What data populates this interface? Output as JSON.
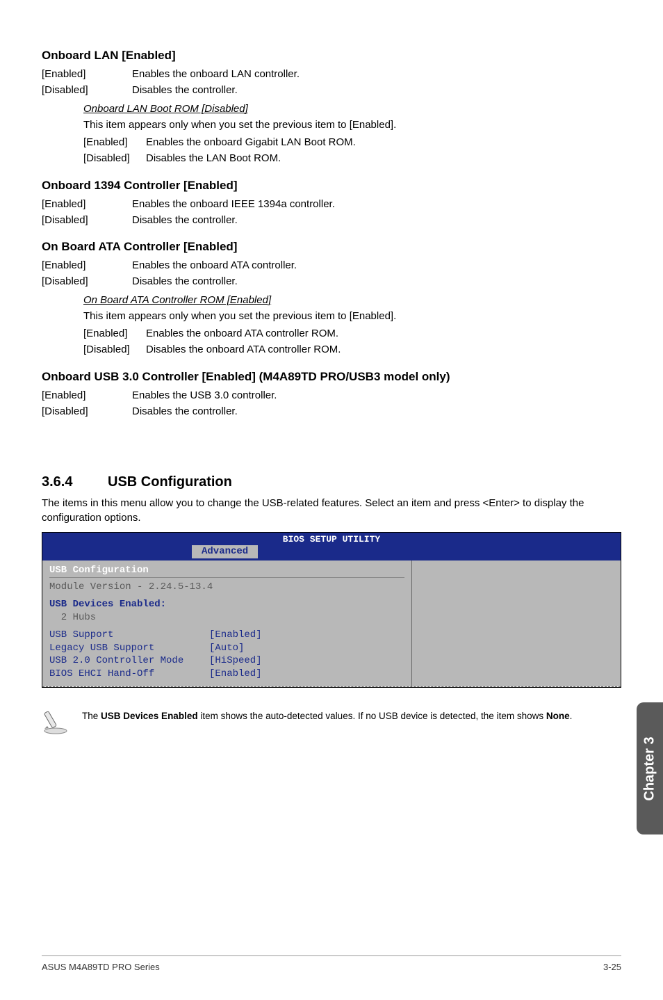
{
  "sections": {
    "onboard_lan": {
      "heading": "Onboard LAN [Enabled]",
      "rows": [
        {
          "key": "[Enabled]",
          "val": "Enables the onboard LAN controller."
        },
        {
          "key": "[Disabled]",
          "val": "Disables the controller."
        }
      ],
      "sub": {
        "heading": "Onboard LAN Boot ROM [Disabled]",
        "text": "This item appears only when you set the previous item to [Enabled].",
        "rows": [
          {
            "key": "[Enabled]",
            "val": "Enables the onboard Gigabit LAN Boot ROM."
          },
          {
            "key": "[Disabled]",
            "val": "Disables the LAN Boot ROM."
          }
        ]
      }
    },
    "onboard_1394": {
      "heading": "Onboard 1394 Controller [Enabled]",
      "rows": [
        {
          "key": "[Enabled]",
          "val": "Enables the onboard IEEE 1394a controller."
        },
        {
          "key": "[Disabled]",
          "val": "Disables the controller."
        }
      ]
    },
    "onboard_ata": {
      "heading": "On Board ATA Controller [Enabled]",
      "rows": [
        {
          "key": "[Enabled]",
          "val": "Enables the onboard ATA controller."
        },
        {
          "key": "[Disabled]",
          "val": "Disables the controller."
        }
      ],
      "sub": {
        "heading": "On Board ATA Controller ROM [Enabled]",
        "text": "This item appears only when you set the previous item to [Enabled].",
        "rows": [
          {
            "key": "[Enabled]",
            "val": "Enables the onboard ATA controller ROM."
          },
          {
            "key": "[Disabled]",
            "val": "Disables the onboard ATA controller ROM."
          }
        ]
      }
    },
    "onboard_usb3": {
      "heading": "Onboard USB 3.0 Controller [Enabled]  (M4A89TD PRO/USB3 model only)",
      "rows": [
        {
          "key": "[Enabled]",
          "val": "Enables the USB 3.0 controller."
        },
        {
          "key": "[Disabled]",
          "val": "Disables the controller."
        }
      ]
    }
  },
  "usb_config": {
    "heading_num": "3.6.4",
    "heading_title": "USB Configuration",
    "intro": "The items in this menu allow you to change the USB-related features. Select an item and press <Enter> to display the configuration options."
  },
  "bios": {
    "title": "BIOS SETUP UTILITY",
    "tab": "Advanced",
    "cfg_title": "USB Configuration",
    "module_version": "Module Version - 2.24.5-13.4",
    "devices_heading": "USB Devices Enabled:",
    "devices_line": "  2 Hubs",
    "settings": [
      {
        "label": "USB Support",
        "value": "[Enabled]"
      },
      {
        "label": "Legacy USB Support",
        "value": "[Auto]"
      },
      {
        "label": "USB 2.0 Controller Mode",
        "value": "[HiSpeed]"
      },
      {
        "label": "BIOS EHCI Hand-Off",
        "value": "[Enabled]"
      }
    ]
  },
  "note": {
    "text_pre": "The ",
    "bold1": "USB Devices Enabled",
    "text_mid": " item shows the auto-detected values. If no USB device is detected, the item shows ",
    "bold2": "None",
    "text_post": "."
  },
  "sidebar": "Chapter 3",
  "footer": {
    "left": "ASUS M4A89TD PRO Series",
    "right": "3-25"
  }
}
